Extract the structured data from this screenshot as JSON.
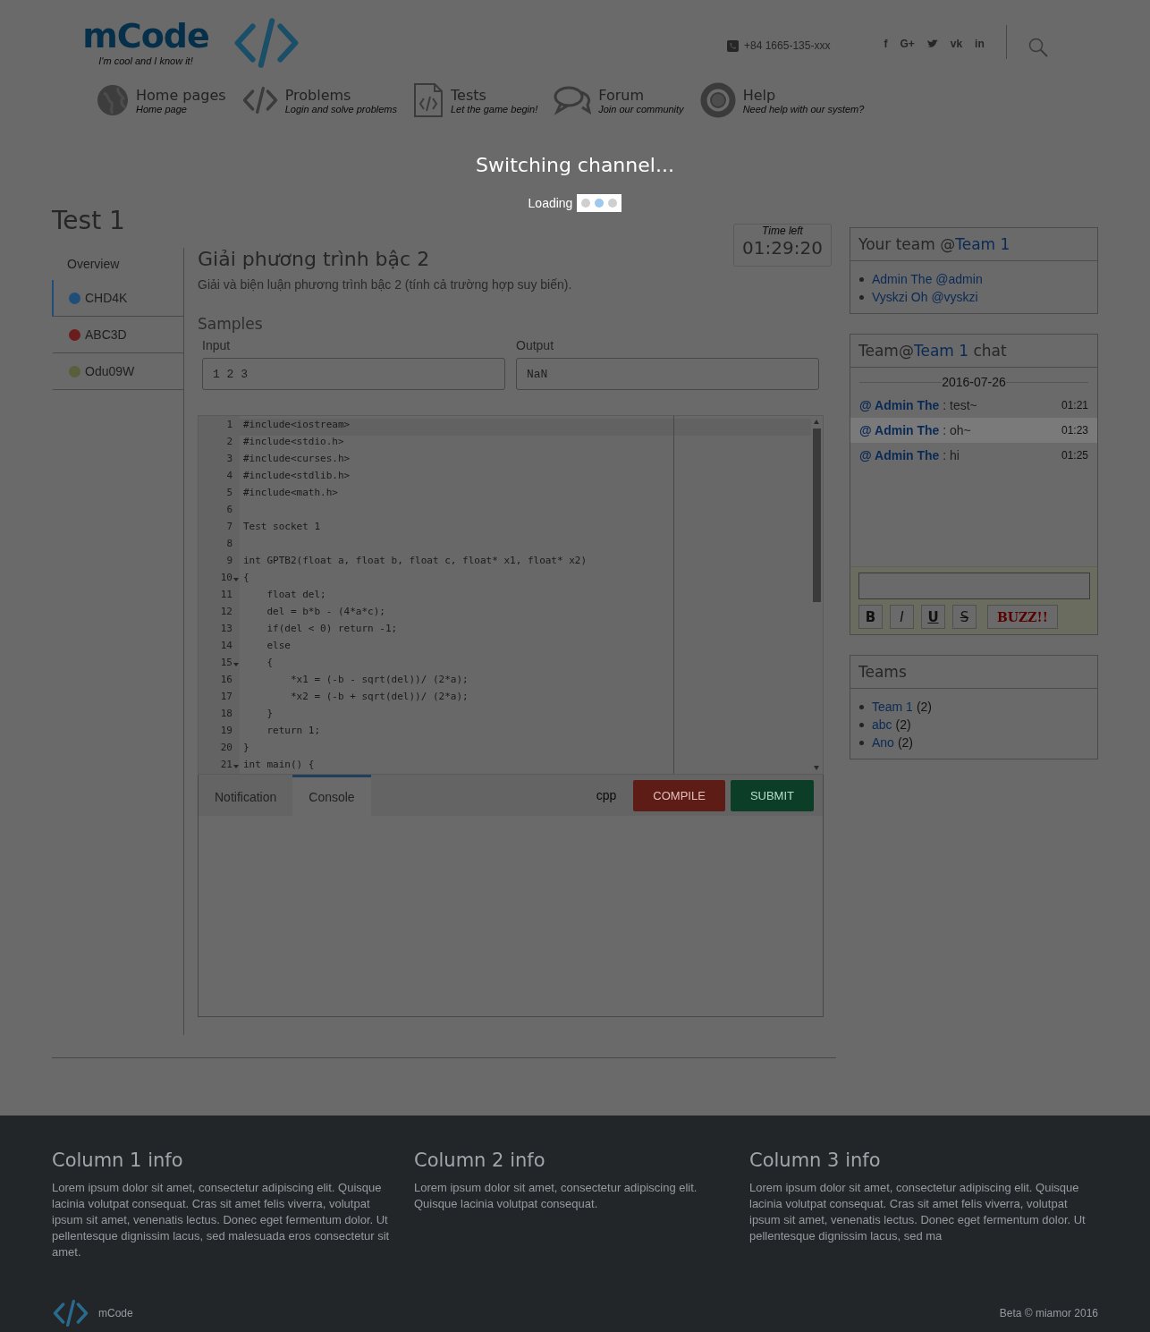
{
  "header": {
    "logo": "mCode",
    "tagline": "I'm cool and I know it!",
    "phone": "+84 1665-135-xxx",
    "social": [
      {
        "kind": "text",
        "label": "f"
      },
      {
        "kind": "text",
        "label": "G+"
      },
      {
        "kind": "bird"
      },
      {
        "kind": "text",
        "label": "vk"
      },
      {
        "kind": "text",
        "label": "in"
      }
    ]
  },
  "nav": [
    {
      "kind": "globe",
      "title": "Home pages",
      "subtitle": "Home page"
    },
    {
      "kind": "code",
      "title": "Problems",
      "subtitle": "Login and solve problems"
    },
    {
      "kind": "document",
      "title": "Tests",
      "subtitle": "Let the game begin!"
    },
    {
      "kind": "chat",
      "title": "Forum",
      "subtitle": "Join our community"
    },
    {
      "kind": "lifebuoy",
      "title": "Help",
      "subtitle": "Need help with our system?"
    }
  ],
  "overlay": {
    "title": "Switching channel...",
    "loading": "Loading",
    "dots": [
      {
        "selected": false
      },
      {
        "selected": true
      },
      {
        "selected": false
      }
    ]
  },
  "page_title": "Test 1",
  "sidebar": {
    "overview": "Overview",
    "problems": [
      {
        "name": "CHD4K",
        "color": "#1f4e79",
        "selected": true
      },
      {
        "name": "ABC3D",
        "color": "#6b1c1c",
        "selected": false
      },
      {
        "name": "Odu09W",
        "color": "#5a5e3a",
        "selected": false
      }
    ]
  },
  "timer": {
    "label": "Time left",
    "value": "01:29:20"
  },
  "problem": {
    "title": "Giải phương trình bậc 2",
    "description": "Giải và biện luận phương trình bậc 2 (tính cả trường hợp suy biến).",
    "samples_heading": "Samples",
    "input_label": "Input",
    "input_value": "1 2 3",
    "output_label": "Output",
    "output_value": "NaN"
  },
  "editor": {
    "lines": [
      {
        "number": "1",
        "code": "#include<iostream>",
        "foldable": false
      },
      {
        "number": "2",
        "code": "#include<stdio.h>",
        "foldable": false
      },
      {
        "number": "3",
        "code": "#include<curses.h>",
        "foldable": false
      },
      {
        "number": "4",
        "code": "#include<stdlib.h>",
        "foldable": false
      },
      {
        "number": "5",
        "code": "#include<math.h>",
        "foldable": false
      },
      {
        "number": "6",
        "foldable": false
      },
      {
        "number": "7",
        "code": "Test socket 1",
        "foldable": false
      },
      {
        "number": "8",
        "foldable": false
      },
      {
        "number": "9",
        "code": "int GPTB2(float a, float b, float c, float* x1, float* x2)",
        "foldable": false
      },
      {
        "number": "10",
        "code": "{",
        "foldable": true
      },
      {
        "number": "11",
        "code": "    float del;",
        "foldable": false
      },
      {
        "number": "12",
        "code": "    del = b*b - (4*a*c);",
        "foldable": false
      },
      {
        "number": "13",
        "code": "    if(del < 0) return -1;",
        "foldable": false
      },
      {
        "number": "14",
        "code": "    else",
        "foldable": false
      },
      {
        "number": "15",
        "code": "    {",
        "foldable": true
      },
      {
        "number": "16",
        "code": "        *x1 = (-b - sqrt(del))/ (2*a);",
        "foldable": false
      },
      {
        "number": "17",
        "code": "        *x2 = (-b + sqrt(del))/ (2*a);",
        "foldable": false
      },
      {
        "number": "18",
        "code": "    }",
        "foldable": false
      },
      {
        "number": "19",
        "code": "    return 1;",
        "foldable": false
      },
      {
        "number": "20",
        "code": "}",
        "foldable": false
      },
      {
        "number": "21",
        "code": "int main() {",
        "foldable": true
      }
    ]
  },
  "console": {
    "tabs": [
      {
        "label": "Notification",
        "selected": false
      },
      {
        "label": "Console",
        "selected": true
      }
    ],
    "language": "cpp",
    "compile": "COMPILE",
    "submit": "SUBMIT"
  },
  "team": {
    "heading": "Your team @",
    "team": "Team 1",
    "members": [
      "Admin The @admin",
      "Vyskzi Oh @vyskzi"
    ]
  },
  "chat": {
    "heading_start": "Team@",
    "team": "Team 1",
    "heading_end": "chat",
    "date": "2016-07-26",
    "messages": [
      {
        "author": "@ Admin The",
        "separator": ":",
        "text": "test~",
        "time": "01:21",
        "selected": false
      },
      {
        "author": "@ Admin The",
        "separator": ":",
        "text": "oh~",
        "time": "01:23",
        "selected": true
      },
      {
        "author": "@ Admin The",
        "separator": ":",
        "text": "hi",
        "time": "01:25",
        "selected": false
      }
    ],
    "format_buttons": [
      {
        "kind": "bold",
        "label": "B"
      },
      {
        "kind": "italic",
        "label": "I"
      },
      {
        "kind": "underline",
        "label": "U"
      },
      {
        "kind": "strike",
        "label": "S"
      },
      {
        "kind": "buzz",
        "label": "BUZZ!!"
      }
    ]
  },
  "teams": {
    "heading": "Teams",
    "items": [
      {
        "name": "Team 1",
        "count": "(2)"
      },
      {
        "name": "abc",
        "count": "(2)"
      },
      {
        "name": "Ano",
        "count": "(2)"
      }
    ]
  },
  "footer": {
    "columns": [
      {
        "title": "Column 1 info",
        "text": "Lorem ipsum dolor sit amet, consectetur adipiscing elit. Quisque lacinia volutpat consequat. Cras sit amet felis viverra, volutpat ipsum sit amet, venenatis lectus. Donec eget fermentum dolor. Ut pellentesque dignissim lacus, sed malesuada eros consectetur sit amet."
      },
      {
        "title": "Column 2 info",
        "text": "Lorem ipsum dolor sit amet, consectetur adipiscing elit. Quisque lacinia volutpat consequat."
      },
      {
        "title": "Column 3 info",
        "text": "Lorem ipsum dolor sit amet, consectetur adipiscing elit. Quisque lacinia volutpat consequat. Cras sit amet felis viverra, volutpat ipsum sit amet, venenatis lectus. Donec eget fermentum dolor. Ut pellentesque dignissim lacus, sed ma"
      }
    ],
    "brand": "mCode",
    "copyright": "Beta © miamor 2016"
  }
}
